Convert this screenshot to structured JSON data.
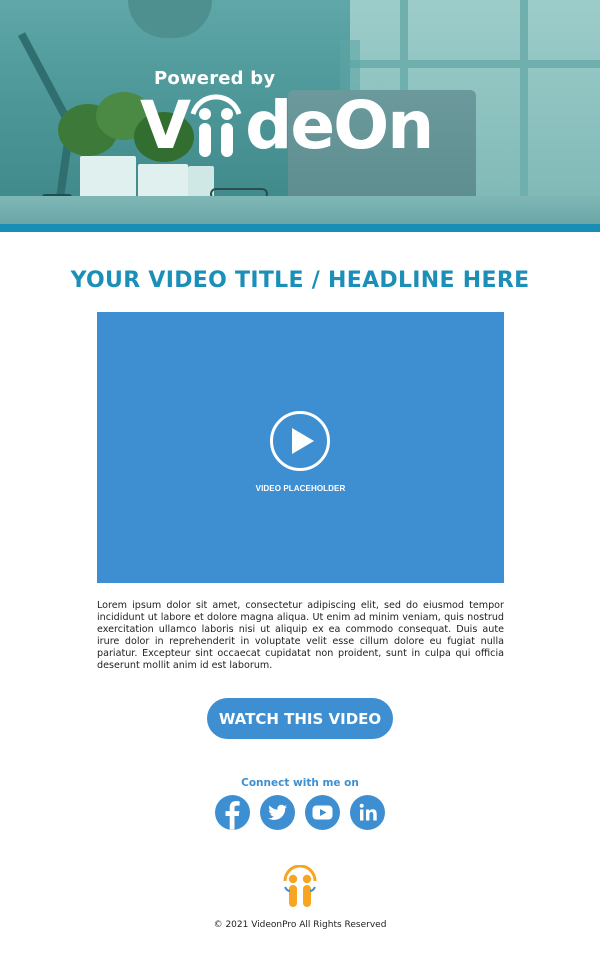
{
  "hero": {
    "powered_by": "Powered by",
    "logo_text_left": "V",
    "logo_text_right": "deOn"
  },
  "main": {
    "headline": "YOUR VIDEO TITLE / HEADLINE HERE",
    "video_label": "VIDEO PLACEHOLDER",
    "body_text": "Lorem ipsum dolor sit amet, consectetur adipiscing elit, sed do eiusmod tempor incididunt ut labore et dolore magna aliqua. Ut enim ad minim veniam, quis nostrud exercitation ullamco laboris nisi ut aliquip ex ea commodo consequat. Duis aute irure dolor in reprehenderit in voluptate velit esse cillum dolore eu fugiat nulla pariatur. Excepteur sint occaecat cupidatat non proident, sunt in culpa qui officia deserunt mollit anim id est laborum.",
    "cta_label": "WATCH THIS VIDEO"
  },
  "social": {
    "heading": "Connect with me on",
    "icons": [
      "facebook-icon",
      "twitter-icon",
      "youtube-icon",
      "linkedin-icon"
    ]
  },
  "footer": {
    "copyright": "© 2021 VideonPro All Rights Reserved"
  },
  "colors": {
    "accent": "#3d8fd2",
    "headline": "#1b8fb8",
    "hero_bar": "#1a8db5",
    "logo_orange": "#f6a623"
  }
}
